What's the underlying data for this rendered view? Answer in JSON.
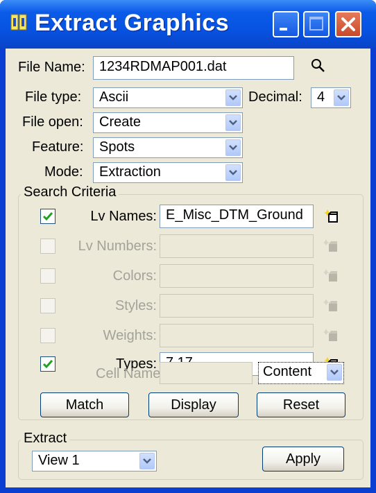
{
  "window": {
    "title": "Extract Graphics"
  },
  "file": {
    "name_label": "File Name:",
    "name_value": "1234RDMAP001.dat"
  },
  "options": {
    "file_type_label": "File type:",
    "file_type_value": "Ascii",
    "decimal_label": "Decimal:",
    "decimal_value": "4",
    "file_open_label": "File open:",
    "file_open_value": "Create",
    "feature_label": "Feature:",
    "feature_value": "Spots",
    "mode_label": "Mode:",
    "mode_value": "Extraction"
  },
  "search": {
    "title": "Search Criteria",
    "rows": [
      {
        "label": "Lv Names:",
        "value": "E_Misc_DTM_Ground",
        "checked": true,
        "enabled": true
      },
      {
        "label": "Lv Numbers:",
        "value": "",
        "checked": false,
        "enabled": false
      },
      {
        "label": "Colors:",
        "value": "",
        "checked": false,
        "enabled": false
      },
      {
        "label": "Styles:",
        "value": "",
        "checked": false,
        "enabled": false
      },
      {
        "label": "Weights:",
        "value": "",
        "checked": false,
        "enabled": false
      },
      {
        "label": "Types:",
        "value": "7,17",
        "checked": true,
        "enabled": true
      }
    ],
    "cell_name_label": "Cell Name:",
    "cell_name_value": "",
    "cell_mode_value": "Content",
    "match_label": "Match",
    "display_label": "Display",
    "reset_label": "Reset"
  },
  "extract": {
    "title": "Extract",
    "view_value": "View 1",
    "apply_label": "Apply"
  },
  "colors": {
    "title_bar": "#0a5ce6",
    "dialog_bg": "#ece9d8",
    "check_green": "#21a121"
  }
}
